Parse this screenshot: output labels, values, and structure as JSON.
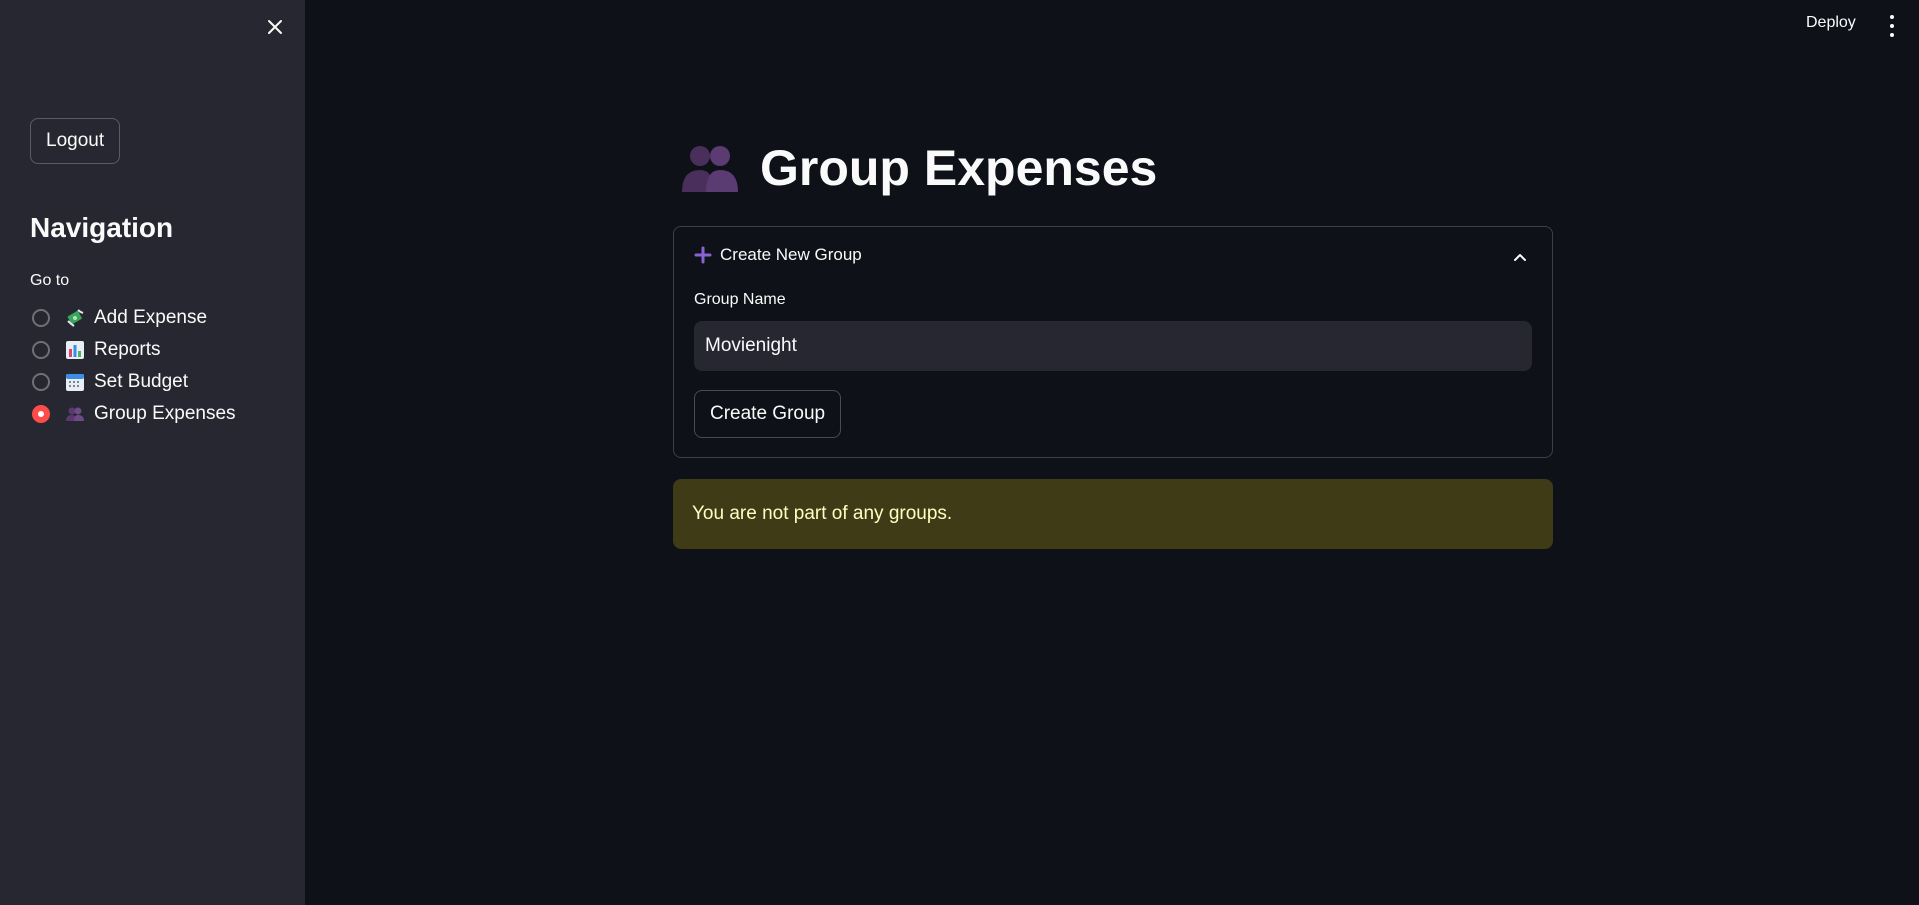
{
  "sidebar": {
    "logout_label": "Logout",
    "nav_title": "Navigation",
    "goto_label": "Go to",
    "items": [
      {
        "label": "Add Expense",
        "icon": "money-with-wings-icon",
        "selected": false
      },
      {
        "label": "Reports",
        "icon": "bar-chart-icon",
        "selected": false
      },
      {
        "label": "Set Budget",
        "icon": "calendar-icon",
        "selected": false
      },
      {
        "label": "Group Expenses",
        "icon": "people-icon",
        "selected": true
      }
    ]
  },
  "header": {
    "deploy_label": "Deploy"
  },
  "main": {
    "title": "Group Expenses",
    "title_icon": "people-icon",
    "expander": {
      "label": "Create New Group",
      "expanded": true,
      "field_label": "Group Name",
      "field_value": "Movienight",
      "button_label": "Create Group"
    },
    "warning": "You are not part of any groups."
  },
  "colors": {
    "sidebar_bg": "#262730",
    "main_bg": "#0e1117",
    "accent": "#ff4b4b",
    "warning_bg": "#3e3b16",
    "warning_text": "#ffffc2",
    "icon_purple": "#8a63d2"
  }
}
